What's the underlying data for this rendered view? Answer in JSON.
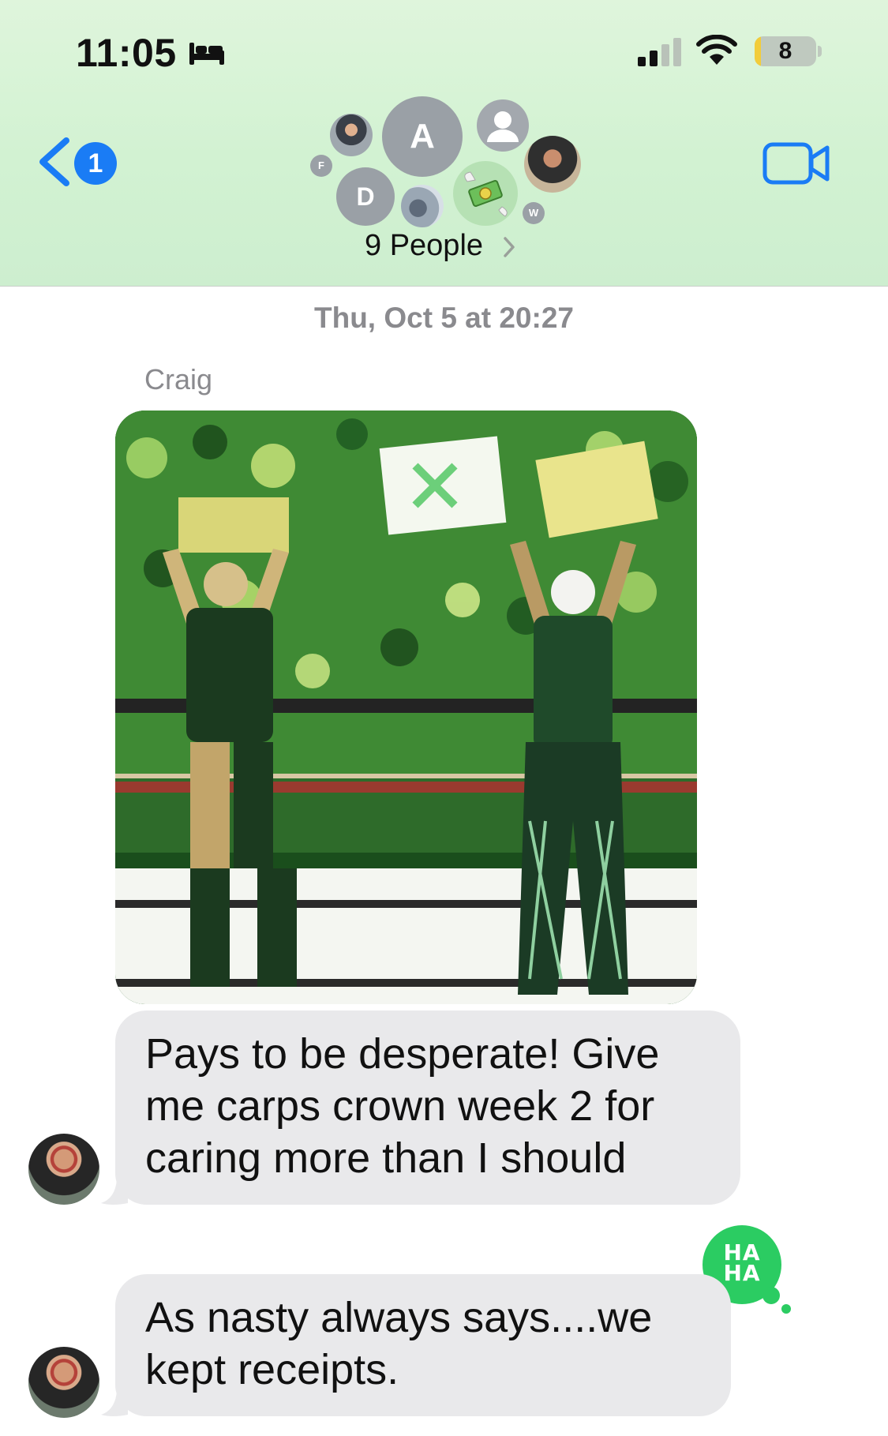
{
  "status_bar": {
    "time": "11:05",
    "battery": "8",
    "battery_level": 0.08
  },
  "header": {
    "unread_count": "1",
    "title": "9 People",
    "avatars": [
      {
        "letter": "A"
      },
      {
        "letter": "D"
      },
      {
        "letter": "F"
      },
      {
        "letter": "W"
      }
    ]
  },
  "conversation": {
    "timestamp": "Thu, Oct 5 at 20:27",
    "sender": "Craig",
    "messages": [
      {
        "text": "Pays to be desperate! Give me carps crown week 2 for caring more than I should"
      },
      {
        "text": "As nasty always says....we kept receipts."
      }
    ],
    "tapback": "HA HA"
  },
  "colors": {
    "accent": "#1a7cf5",
    "header_bg": "#d4f2d3",
    "bubble_bg": "#e9e9eb",
    "tapback": "#2bcc62"
  }
}
